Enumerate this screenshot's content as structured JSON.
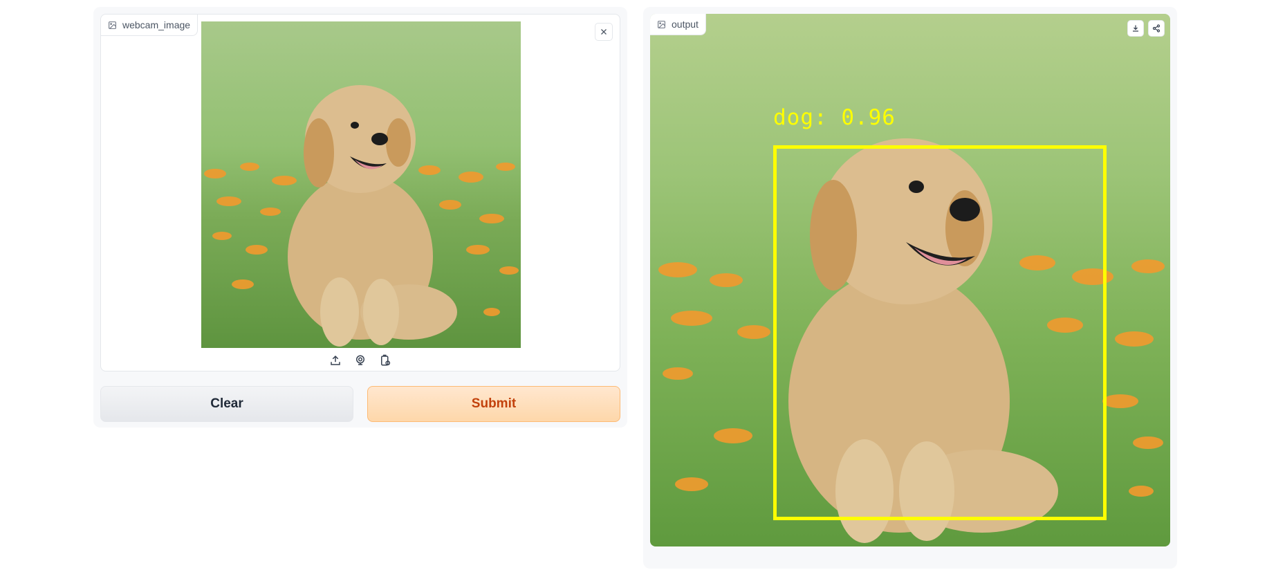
{
  "input": {
    "label": "webcam_image",
    "label_icon": "image-icon",
    "close_icon": "close-icon",
    "sources": [
      {
        "name": "upload-icon"
      },
      {
        "name": "webcam-icon"
      },
      {
        "name": "clipboard-icon"
      }
    ]
  },
  "actions": {
    "clear_label": "Clear",
    "submit_label": "Submit"
  },
  "output": {
    "label": "output",
    "label_icon": "image-icon",
    "download_icon": "download-icon",
    "share_icon": "share-icon",
    "detection": {
      "label": "dog: 0.96",
      "color": "#ffff00"
    }
  },
  "colors": {
    "submit_bg": "#fed7aa",
    "submit_text": "#c2410c",
    "clear_bg": "#e5e7eb"
  }
}
